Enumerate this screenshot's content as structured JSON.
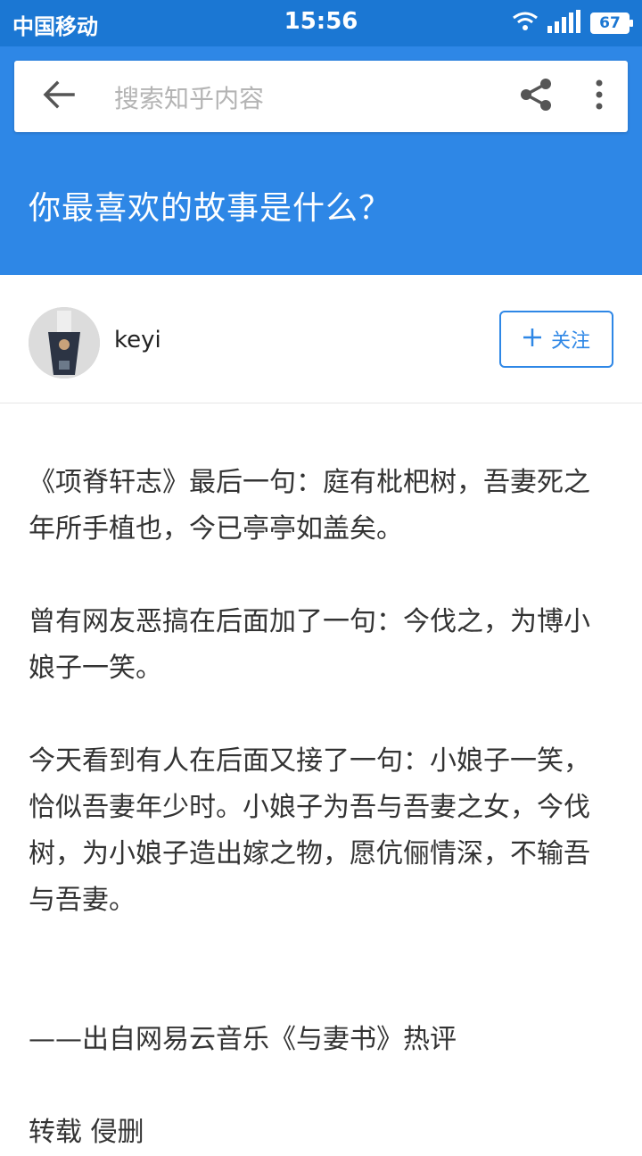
{
  "status_bar": {
    "carrier": "中国移动",
    "time": "15:56",
    "battery": "67",
    "icons": [
      "wifi-icon",
      "signal-icon",
      "battery-icon"
    ]
  },
  "header": {
    "search_placeholder": "搜索知乎内容",
    "question_title": "你最喜欢的故事是什么？",
    "icons": [
      "back-arrow-icon",
      "share-icon",
      "more-vertical-icon"
    ]
  },
  "author": {
    "name": "keyi",
    "follow_label": "关注"
  },
  "answer": {
    "paragraphs": [
      "《项脊轩志》最后一句：庭有枇杷树，吾妻死之年所手植也，今已亭亭如盖矣。",
      "曾有网友恶搞在后面加了一句：今伐之，为博小娘子一笑。",
      "今天看到有人在后面又接了一句：小娘子一笑，恰似吾妻年少时。小娘子为吾与吾妻之女，今伐树，为小娘子造出嫁之物，愿伉俪情深，不输吾与吾妻。",
      "——出自网易云音乐《与妻书》热评",
      "转载 侵删"
    ]
  },
  "colors": {
    "status_bar": "#1b77d3",
    "header": "#2e87e6",
    "accent": "#2e87e6",
    "body_text": "#333333"
  }
}
